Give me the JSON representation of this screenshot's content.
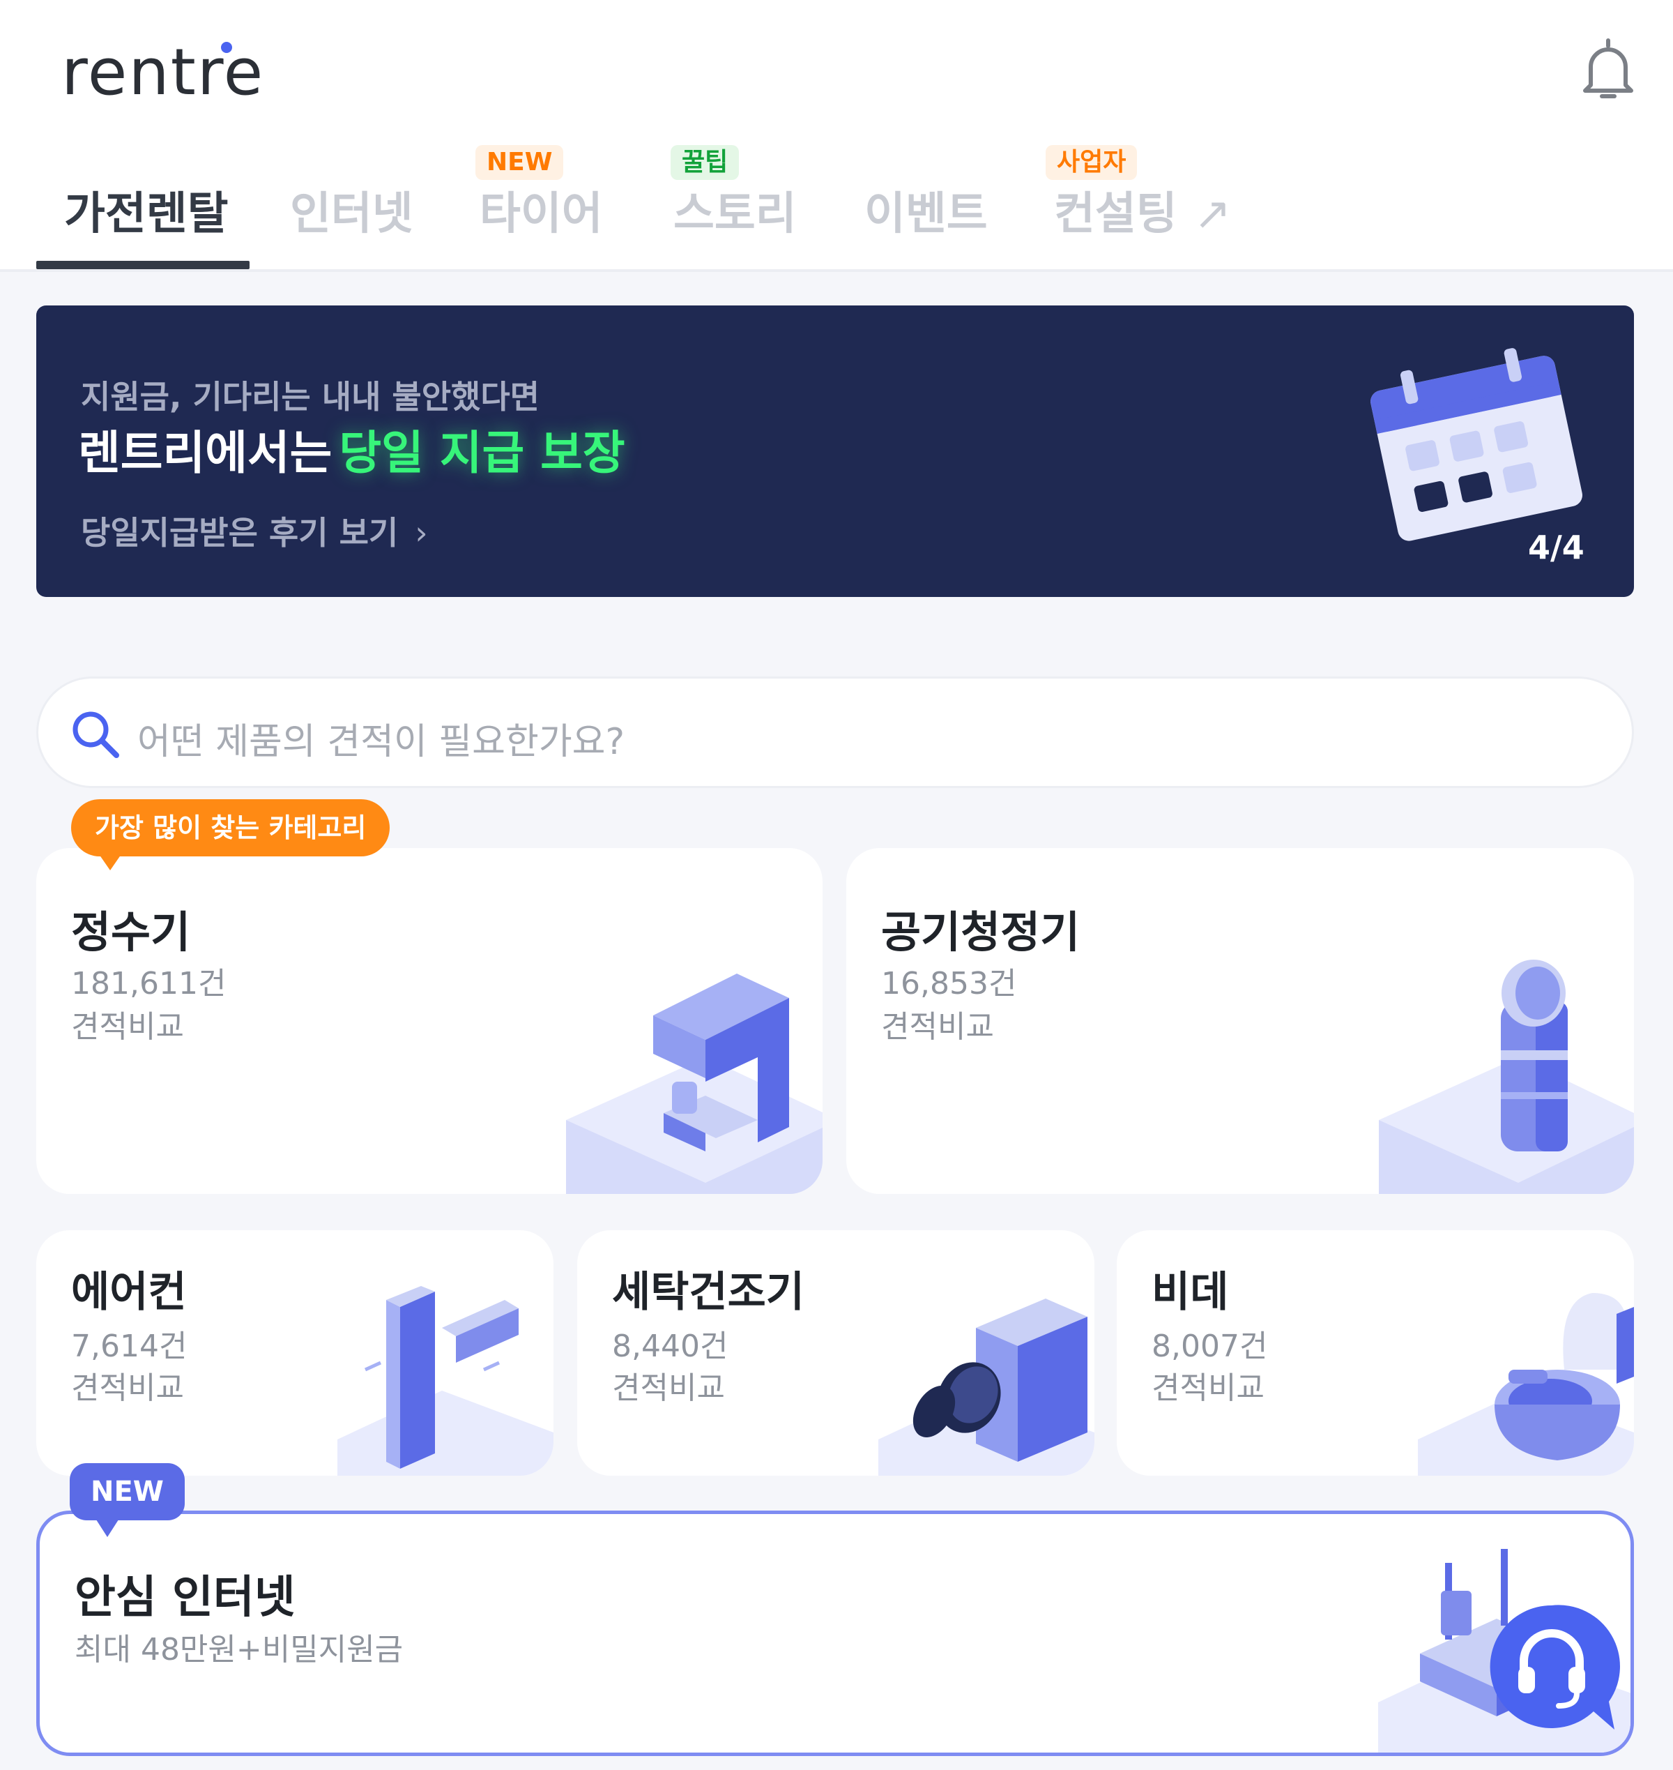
{
  "header": {
    "logo_text": "rentre",
    "tabs": [
      {
        "label": "가전렌탈",
        "active": true,
        "badge": ""
      },
      {
        "label": "인터넷",
        "active": false,
        "badge": ""
      },
      {
        "label": "타이어",
        "active": false,
        "badge": "NEW"
      },
      {
        "label": "스토리",
        "active": false,
        "badge": "꿀팁"
      },
      {
        "label": "이벤트",
        "active": false,
        "badge": ""
      },
      {
        "label": "컨설팅",
        "active": false,
        "badge": "사업자",
        "external_icon": "↗"
      }
    ]
  },
  "banner": {
    "subtitle": "지원금, 기다리는 내내 불안했다면",
    "title_prefix": "렌트리에서는",
    "title_highlight": "당일 지급 보장",
    "link_label": "당일지급받은 후기 보기",
    "link_chevron": "›",
    "pager": "4/4"
  },
  "search": {
    "placeholder": "어떤 제품의 견적이 필요한가요?"
  },
  "categories": {
    "popular_tag": "가장 많이 찾는 카테고리",
    "compare_label": "견적비교",
    "items": [
      {
        "name": "정수기",
        "count": "181,611건"
      },
      {
        "name": "공기청정기",
        "count": "16,853건"
      },
      {
        "name": "에어컨",
        "count": "7,614건"
      },
      {
        "name": "세탁건조기",
        "count": "8,440건"
      },
      {
        "name": "비데",
        "count": "8,007건"
      }
    ]
  },
  "internet_card": {
    "tag": "NEW",
    "title": "안심 인터넷",
    "subtitle": "최대 48만원+비밀지원금"
  },
  "colors": {
    "accent": "#5b6be6",
    "banner_bg": "#1f2952",
    "highlight_green": "#37f57a",
    "orange": "#ff8a14"
  },
  "icons": [
    "bell-icon",
    "search-icon",
    "calendar-illustration",
    "external-link-icon",
    "chat-support-icon"
  ]
}
